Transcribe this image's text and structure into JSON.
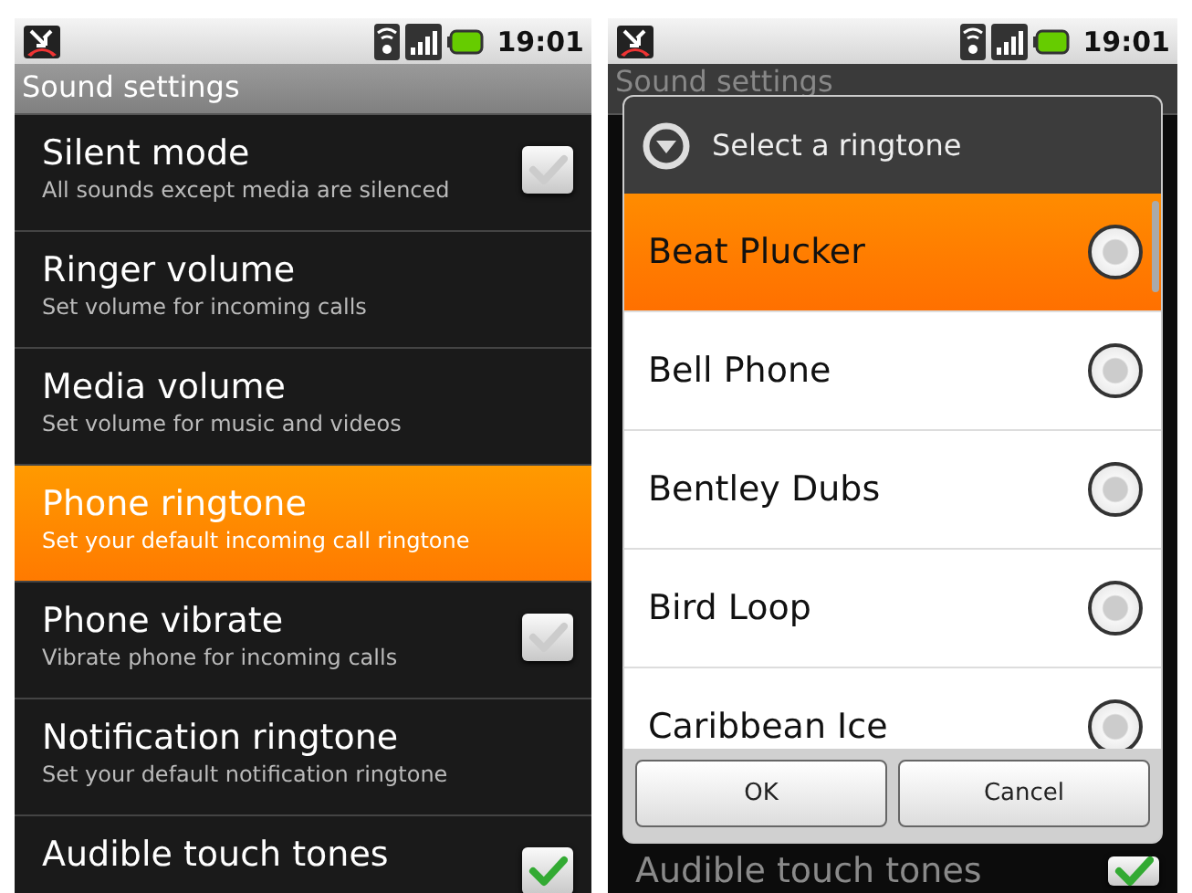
{
  "screens": [
    {
      "status_bar": {
        "time": "19:01"
      },
      "title": "Sound settings",
      "dimmed": false,
      "settings": [
        {
          "kind": "checkbox",
          "title": "Silent mode",
          "summary": "All sounds except media are silenced",
          "checked": false,
          "selected": false
        },
        {
          "kind": "plain",
          "title": "Ringer volume",
          "summary": "Set volume for incoming calls",
          "selected": false
        },
        {
          "kind": "plain",
          "title": "Media volume",
          "summary": "Set volume for music and videos",
          "selected": false
        },
        {
          "kind": "plain",
          "title": "Phone ringtone",
          "summary": "Set your default incoming call ringtone",
          "selected": true
        },
        {
          "kind": "checkbox",
          "title": "Phone vibrate",
          "summary": "Vibrate phone for incoming calls",
          "checked": false,
          "selected": false
        },
        {
          "kind": "plain",
          "title": "Notification ringtone",
          "summary": "Set your default notification ringtone",
          "selected": false
        },
        {
          "kind": "checkbox",
          "title": "Audible touch tones",
          "checked": true,
          "selected": false
        }
      ]
    },
    {
      "status_bar": {
        "time": "19:01"
      },
      "title": "Sound settings",
      "dimmed": true,
      "settings": [
        {
          "kind": "checkbox",
          "title": "Audible touch tones",
          "checked": true,
          "selected": false
        }
      ],
      "dialog": {
        "title": "Select a ringtone",
        "items": [
          {
            "label": "Beat Plucker",
            "selected": true,
            "checked": false
          },
          {
            "label": "Bell Phone",
            "selected": false,
            "checked": false
          },
          {
            "label": "Bentley Dubs",
            "selected": false,
            "checked": false
          },
          {
            "label": "Bird Loop",
            "selected": false,
            "checked": false
          },
          {
            "label": "Caribbean Ice",
            "selected": false,
            "checked": false
          }
        ],
        "buttons": [
          "OK",
          "Cancel"
        ]
      }
    }
  ]
}
